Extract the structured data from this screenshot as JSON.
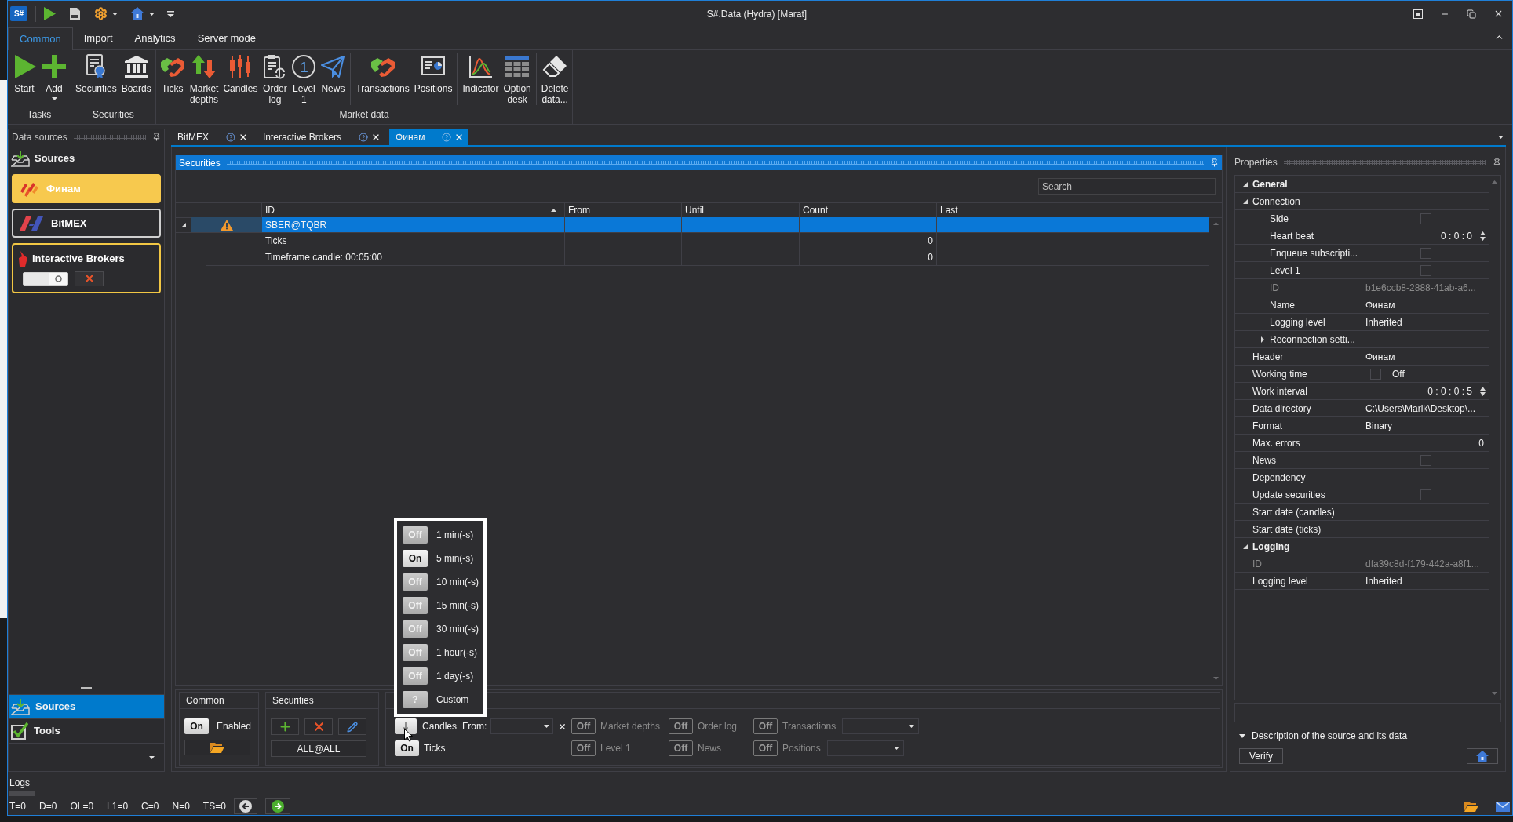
{
  "window": {
    "app_logo": "S#",
    "title": "S#.Data (Hydra) [Marat]"
  },
  "ribbon": {
    "tabs": [
      {
        "label": "Common",
        "selected": true
      },
      {
        "label": "Import",
        "selected": false
      },
      {
        "label": "Analytics",
        "selected": false
      },
      {
        "label": "Server mode",
        "selected": false
      }
    ],
    "groups": [
      {
        "label": "Tasks",
        "sections": [
          {
            "buttons": [
              {
                "label": "Start",
                "kind": "start"
              },
              {
                "label": "Add",
                "kind": "add",
                "dropdown": true
              }
            ]
          }
        ]
      },
      {
        "label": "Securities",
        "sections": [
          {
            "buttons": [
              {
                "label": "Securities",
                "kind": "securities"
              },
              {
                "label": "Boards",
                "kind": "boards"
              }
            ]
          }
        ]
      },
      {
        "label": "Market data",
        "sections": [
          {
            "buttons": [
              {
                "label": "Ticks",
                "kind": "ticks"
              },
              {
                "label": "Market depths",
                "kind": "depths"
              },
              {
                "label": "Candles",
                "kind": "candles"
              },
              {
                "label": "Order log",
                "kind": "orderlog"
              },
              {
                "label": "Level 1",
                "kind": "level",
                "glyph": "1"
              },
              {
                "label": "News",
                "kind": "news"
              }
            ]
          },
          {
            "buttons": [
              {
                "label": "Transactions",
                "kind": "transactions"
              },
              {
                "label": "Positions",
                "kind": "positions"
              }
            ]
          },
          {
            "buttons": [
              {
                "label": "Indicator",
                "kind": "indicator"
              },
              {
                "label": "Option desk",
                "kind": "optiondesk"
              }
            ]
          },
          {
            "buttons": [
              {
                "label": "Delete data...",
                "kind": "delete"
              }
            ]
          }
        ]
      }
    ]
  },
  "data_sources": {
    "title": "Data sources",
    "heading": "Sources",
    "sources": [
      {
        "name": "Финам",
        "kind": "finam",
        "selected": true,
        "color": "#f7c94e",
        "expanded": false
      },
      {
        "name": "BitMEX",
        "kind": "bitmex",
        "selected": false,
        "color": "#cfcfcf",
        "expanded": false
      },
      {
        "name": "Interactive Brokers",
        "kind": "ib",
        "selected": false,
        "color": "#f2c744",
        "expanded": true,
        "enabled": false
      }
    ],
    "nav": [
      {
        "label": "Sources",
        "kind": "sources",
        "selected": true
      },
      {
        "label": "Tools",
        "kind": "tools",
        "selected": false
      }
    ]
  },
  "documents": {
    "tabs": [
      {
        "label": "BitMEX",
        "selected": false
      },
      {
        "label": "Interactive Brokers",
        "selected": false
      },
      {
        "label": "Финам",
        "selected": true
      }
    ]
  },
  "securities": {
    "title": "Securities",
    "search": {
      "placeholder": "Search"
    },
    "columns": [
      {
        "label": "ID",
        "sorted": true
      },
      {
        "label": "From",
        "sorted": false
      },
      {
        "label": "Until",
        "sorted": false
      },
      {
        "label": "Count",
        "sorted": false
      },
      {
        "label": "Last",
        "sorted": false
      }
    ],
    "rows": [
      {
        "id": "SBER@TQBR",
        "selected": true,
        "expanded": true,
        "warning": true,
        "children": [
          {
            "id": "Ticks",
            "count": "0"
          },
          {
            "id": "Timeframe candle: 00:05:00",
            "count": "0"
          }
        ]
      }
    ]
  },
  "settings": {
    "common": {
      "title": "Common",
      "enabled": {
        "toggle": "On",
        "on": true,
        "label": "Enabled"
      }
    },
    "securities": {
      "title": "Securities",
      "filter": "ALL@ALL"
    },
    "candles": {
      "label": "Candles",
      "on": true,
      "from_label": "From:",
      "menu_open": true
    },
    "ticks": {
      "toggle": "On",
      "label": "Ticks",
      "on": true
    },
    "types": [
      {
        "toggle": "Off",
        "label": "Market depths",
        "on": false,
        "kind": "plain"
      },
      {
        "toggle": "Off",
        "label": "Order log",
        "on": false,
        "kind": "plain"
      },
      {
        "toggle": "Off",
        "label": "Transactions",
        "on": false,
        "kind": "select"
      },
      {
        "toggle": "Off",
        "label": "Level 1",
        "on": false,
        "kind": "plain"
      },
      {
        "toggle": "Off",
        "label": "News",
        "on": false,
        "kind": "plain"
      },
      {
        "toggle": "Off",
        "label": "Positions",
        "on": false,
        "kind": "select"
      }
    ],
    "timeframes": [
      {
        "toggle": "Off",
        "label": "1 min(-s)",
        "on": false
      },
      {
        "toggle": "On",
        "label": "5 min(-s)",
        "on": true
      },
      {
        "toggle": "Off",
        "label": "10 min(-s)",
        "on": false
      },
      {
        "toggle": "Off",
        "label": "15 min(-s)",
        "on": false
      },
      {
        "toggle": "Off",
        "label": "30 min(-s)",
        "on": false
      },
      {
        "toggle": "Off",
        "label": "1 hour(-s)",
        "on": false
      },
      {
        "toggle": "Off",
        "label": "1 day(-s)",
        "on": false
      },
      {
        "toggle": "?",
        "label": "Custom",
        "on": false
      }
    ]
  },
  "properties": {
    "title": "Properties",
    "items": [
      {
        "kind": "category",
        "label": "General",
        "expanded": true,
        "children": [
          {
            "kind": "group",
            "label": "Connection",
            "expanded": true,
            "children": [
              {
                "kind": "checkbox",
                "label": "Side",
                "checked": false
              },
              {
                "kind": "spinner",
                "label": "Heart beat",
                "value": "0 : 0 : 0"
              },
              {
                "kind": "checkbox",
                "label": "Enqueue subscripti...",
                "checked": false
              },
              {
                "kind": "checkbox",
                "label": "Level 1",
                "checked": false
              },
              {
                "kind": "text",
                "label": "ID",
                "value": "b1e6ccb8-2888-41ab-a6...",
                "disabled": true
              },
              {
                "kind": "text",
                "label": "Name",
                "value": "Финам",
                "disabled": false
              },
              {
                "kind": "text",
                "label": "Logging level",
                "value": "Inherited",
                "disabled": false
              },
              {
                "kind": "group",
                "label": "Reconnection setti...",
                "expanded": false
              }
            ]
          },
          {
            "kind": "text",
            "label": "Header",
            "value": "Финам",
            "disabled": false
          },
          {
            "kind": "checkbox",
            "label": "Working time",
            "checked": false,
            "value": "Off"
          },
          {
            "kind": "spinner",
            "label": "Work interval",
            "value": "0 : 0 : 0 : 5"
          },
          {
            "kind": "text",
            "label": "Data directory",
            "value": "C:\\Users\\Marik\\Desktop\\...",
            "disabled": false
          },
          {
            "kind": "text",
            "label": "Format",
            "value": "Binary",
            "disabled": false
          },
          {
            "kind": "number",
            "label": "Max. errors",
            "value": "0"
          },
          {
            "kind": "checkbox",
            "label": "News",
            "checked": false
          },
          {
            "kind": "text",
            "label": "Dependency",
            "disabled": false
          },
          {
            "kind": "checkbox",
            "label": "Update securities",
            "checked": false
          },
          {
            "kind": "text",
            "label": "Start date (candles)",
            "disabled": false
          },
          {
            "kind": "text",
            "label": "Start date (ticks)",
            "disabled": false
          }
        ]
      },
      {
        "kind": "category",
        "label": "Logging",
        "expanded": true,
        "children": [
          {
            "kind": "text",
            "label": "ID",
            "value": "dfa39c8d-f179-442a-a8f1...",
            "disabled": true
          },
          {
            "kind": "text",
            "label": "Logging level",
            "value": "Inherited",
            "disabled": false
          }
        ]
      }
    ],
    "description": {
      "label": "Description of the source and its data",
      "expanded": true
    },
    "verify": "Verify"
  },
  "logs": {
    "title": "Logs",
    "counters": [
      "T=0",
      "D=0",
      "OL=0",
      "L1=0",
      "C=0",
      "N=0",
      "TS=0"
    ]
  }
}
